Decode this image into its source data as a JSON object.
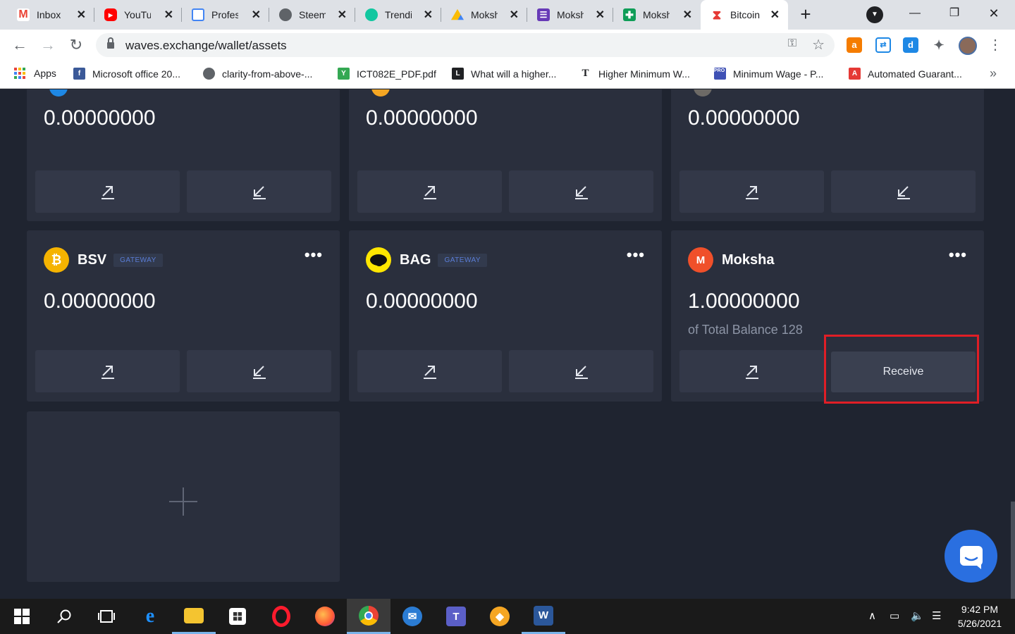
{
  "tabs": [
    {
      "label": "Inbox (",
      "icon": "gmail-icon",
      "color": "#ea4335"
    },
    {
      "label": "YouTub",
      "icon": "youtube-icon",
      "color": "#ff0000"
    },
    {
      "label": "Profes",
      "icon": "doc-icon",
      "color": "#4285f4"
    },
    {
      "label": "Steem",
      "icon": "globe-icon",
      "color": "#5f6368"
    },
    {
      "label": "Trendi",
      "icon": "trending-icon",
      "color": "#12c7a0"
    },
    {
      "label": "Moksh",
      "icon": "drive-icon",
      "color": "#fbbc05"
    },
    {
      "label": "Moksh",
      "icon": "forms-icon",
      "color": "#673ab7"
    },
    {
      "label": "Moksh",
      "icon": "sheets-icon",
      "color": "#0f9d58"
    },
    {
      "label": "Bitcoin",
      "icon": "waves-icon",
      "color": "#e53935"
    }
  ],
  "address": {
    "url": "waves.exchange/wallet/assets"
  },
  "bookmarks": [
    {
      "label": "Apps",
      "icon": "apps-icon"
    },
    {
      "label": "Microsoft office 20...",
      "icon": "facebook-icon",
      "color": "#3b5998"
    },
    {
      "label": "clarity-from-above-...",
      "icon": "globe-icon",
      "color": "#5f6368"
    },
    {
      "label": "ICT082E_PDF.pdf",
      "icon": "plant-icon",
      "color": "#34a853"
    },
    {
      "label": "What will a higher...",
      "icon": "letter-l-icon",
      "color": "#202124"
    },
    {
      "label": "Higher Minimum W...",
      "icon": "nyt-icon",
      "color": "#202124"
    },
    {
      "label": "Minimum Wage - P...",
      "icon": "procon-icon",
      "color": "#3f51b5"
    },
    {
      "label": "Automated Guarant...",
      "icon": "adobe-icon",
      "color": "#e53935"
    }
  ],
  "wallet": {
    "top_cards": [
      {
        "balance_int": "0.",
        "balance_dec": "00000000"
      },
      {
        "balance_int": "0.",
        "balance_dec": "00000000"
      },
      {
        "balance_int": "0.",
        "balance_dec": "00000000"
      }
    ],
    "cards": [
      {
        "name": "BSV",
        "badge": "GATEWAY",
        "coin_letter": "₿",
        "coin_color": "#f5b300",
        "balance_int": "0.",
        "balance_dec": "00000000"
      },
      {
        "name": "BAG",
        "badge": "GATEWAY",
        "coin_letter": "",
        "coin_color": "#ffe600",
        "balance_int": "0.",
        "balance_dec": "00000000"
      },
      {
        "name": "Moksha",
        "badge": "",
        "coin_letter": "M",
        "coin_color": "#f0502a",
        "balance_int": "1.",
        "balance_dec": "00000000",
        "sub_balance": "of Total Balance 128",
        "receive_label": "Receive"
      }
    ],
    "more_glyph": "•••"
  },
  "taskbar": {
    "time": "9:42 PM",
    "date": "5/26/2021"
  }
}
